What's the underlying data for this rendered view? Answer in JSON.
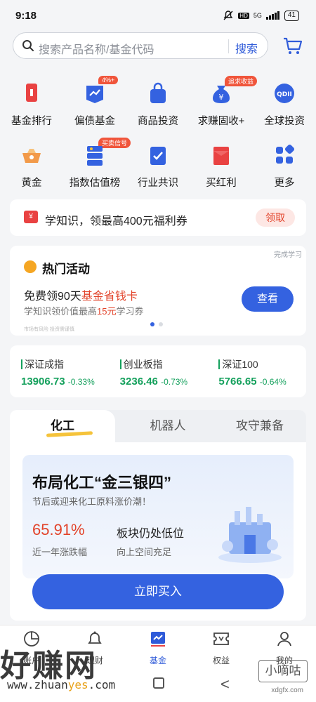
{
  "status_bar": {
    "time": "9:18",
    "network": "5G",
    "battery": "41",
    "hd": "HD"
  },
  "search": {
    "placeholder": "搜索产品名称/基金代码",
    "button": "搜索"
  },
  "shortcuts": [
    {
      "label": "基金排行",
      "icon": "ranking-icon",
      "color": "#e94242"
    },
    {
      "label": "偏债基金",
      "icon": "bond-fund-icon",
      "color": "#3462e0",
      "tag": "4%+"
    },
    {
      "label": "商品投资",
      "icon": "shopping-bag-icon",
      "color": "#3462e0"
    },
    {
      "label": "求赚固收+",
      "icon": "money-bag-icon",
      "color": "#3462e0",
      "tag": "追求收益"
    },
    {
      "label": "全球投资",
      "icon": "qdii-icon",
      "color": "#3462e0",
      "badge": "QDII"
    },
    {
      "label": "黄金",
      "icon": "gold-icon",
      "color": "#f29a4a"
    },
    {
      "label": "指数估值榜",
      "icon": "index-valuation-icon",
      "color": "#3462e0",
      "tag": "买卖信号"
    },
    {
      "label": "行业共识",
      "icon": "checklist-icon",
      "color": "#3462e0"
    },
    {
      "label": "买红利",
      "icon": "red-envelope-icon",
      "color": "#e94242"
    },
    {
      "label": "更多",
      "icon": "more-grid-icon",
      "color": "#3462e0"
    }
  ],
  "promo": {
    "icon_text": "¥",
    "text": "学知识，领最高400元福利券",
    "button": "领取"
  },
  "hot": {
    "corner": "完成学习",
    "title": "热门活动",
    "line1_a": "免费领90天",
    "line1_b": "基金省钱卡",
    "line2_a": "学知识领价值最高",
    "line2_b": "15元",
    "line2_c": "学习券",
    "button": "查看",
    "note": "市场有风险 投资需谨慎"
  },
  "indices": [
    {
      "name": "深证成指",
      "value": "13906.73",
      "change": "-0.33%"
    },
    {
      "name": "创业板指",
      "value": "3236.46",
      "change": "-0.73%"
    },
    {
      "name": "深证100",
      "value": "5766.65",
      "change": "-0.64%"
    }
  ],
  "theme": {
    "tabs": [
      "化工",
      "机器人",
      "攻守兼备"
    ],
    "headline": "布局化工“金三银四”",
    "subline": "节后或迎来化工原料涨价潮！",
    "return_value": "65.91%",
    "return_label": "近一年涨跌幅",
    "point_title": "板块仍处低位",
    "point_sub": "向上空间充足",
    "buy_button": "立即买入"
  },
  "bottom_nav": [
    {
      "label": "账户",
      "icon": "pie-chart-icon"
    },
    {
      "label": "理财",
      "icon": "bell-icon"
    },
    {
      "label": "基金",
      "icon": "fund-chart-icon",
      "active": true
    },
    {
      "label": "权益",
      "icon": "coupon-icon"
    },
    {
      "label": "我的",
      "icon": "user-icon"
    }
  ],
  "watermark": {
    "main": "好赚网",
    "url_a": "www.zhuan",
    "url_b": "yes",
    "url_c": ".com",
    "right": "小嘀咕",
    "right_url": "xdgfx.com"
  },
  "colors": {
    "accent": "#3462e0",
    "red": "#e2432a",
    "green": "#14a05c"
  }
}
